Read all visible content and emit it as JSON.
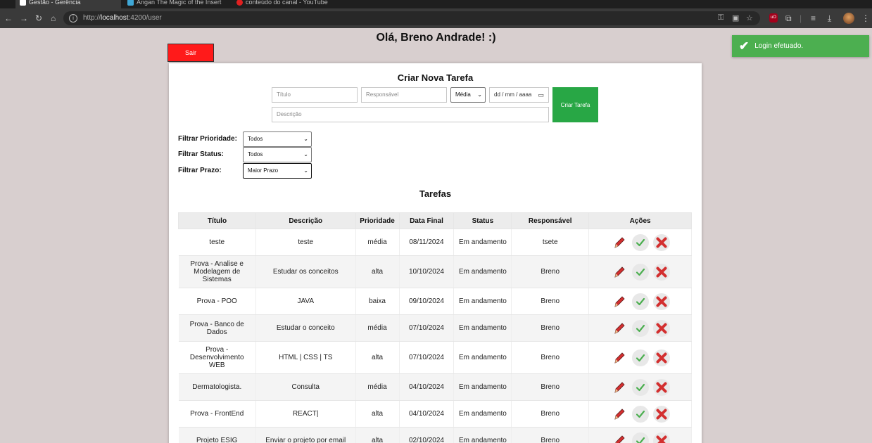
{
  "browser": {
    "tabs": [
      {
        "label": "Gestão - Gerência"
      },
      {
        "label": "Angan The Magic of the Insert"
      },
      {
        "label": "conteúdo do canal - YouTube"
      }
    ],
    "url_protocol": "http://",
    "url_host": "localhost",
    "url_path": ":4200/user"
  },
  "header": {
    "greeting": "Olá, Breno Andrade! :)",
    "logout_label": "Sair"
  },
  "toast": {
    "message": "Login efetuado."
  },
  "form": {
    "title": "Criar Nova Tarefa",
    "title_placeholder": "Título",
    "responsible_placeholder": "Responsável",
    "priority_value": "Média",
    "date_placeholder": "dd / mm / aaaa",
    "description_placeholder": "Descrição",
    "submit_label": "Criar Tarefa"
  },
  "filters": {
    "priority_label": "Filtrar Prioridade:",
    "priority_value": "Todos",
    "status_label": "Filtrar Status:",
    "status_value": "Todos",
    "deadline_label": "Filtrar Prazo:",
    "deadline_value": "Maior Prazo"
  },
  "tasks": {
    "title": "Tarefas",
    "columns": [
      "Título",
      "Descrição",
      "Prioridade",
      "Data Final",
      "Status",
      "Responsável",
      "Ações"
    ],
    "rows": [
      {
        "title": "teste",
        "description": "teste",
        "priority": "média",
        "date": "08/11/2024",
        "status": "Em andamento",
        "responsible": "tsete"
      },
      {
        "title": "Prova - Analise e Modelagem de Sistemas",
        "description": "Estudar os conceitos",
        "priority": "alta",
        "date": "10/10/2024",
        "status": "Em andamento",
        "responsible": "Breno"
      },
      {
        "title": "Prova - POO",
        "description": "JAVA",
        "priority": "baixa",
        "date": "09/10/2024",
        "status": "Em andamento",
        "responsible": "Breno"
      },
      {
        "title": "Prova - Banco de Dados",
        "description": "Estudar o conceito",
        "priority": "média",
        "date": "07/10/2024",
        "status": "Em andamento",
        "responsible": "Breno"
      },
      {
        "title": "Prova - Desenvolvimento WEB",
        "description": "HTML | CSS | TS",
        "priority": "alta",
        "date": "07/10/2024",
        "status": "Em andamento",
        "responsible": "Breno"
      },
      {
        "title": "Dermatologista.",
        "description": "Consulta",
        "priority": "média",
        "date": "04/10/2024",
        "status": "Em andamento",
        "responsible": "Breno"
      },
      {
        "title": "Prova - FrontEnd",
        "description": "REACT|",
        "priority": "alta",
        "date": "04/10/2024",
        "status": "Em andamento",
        "responsible": "Breno"
      },
      {
        "title": "Projeto ESIG",
        "description": "Enviar o projeto por email",
        "priority": "alta",
        "date": "02/10/2024",
        "status": "Em andamento",
        "responsible": "Breno"
      }
    ],
    "action_icons": [
      "pencil-icon",
      "check-icon",
      "x-icon"
    ],
    "colors": {
      "edit": "#d32f2f",
      "complete": "#4caf50",
      "delete": "#d32f2f"
    }
  }
}
